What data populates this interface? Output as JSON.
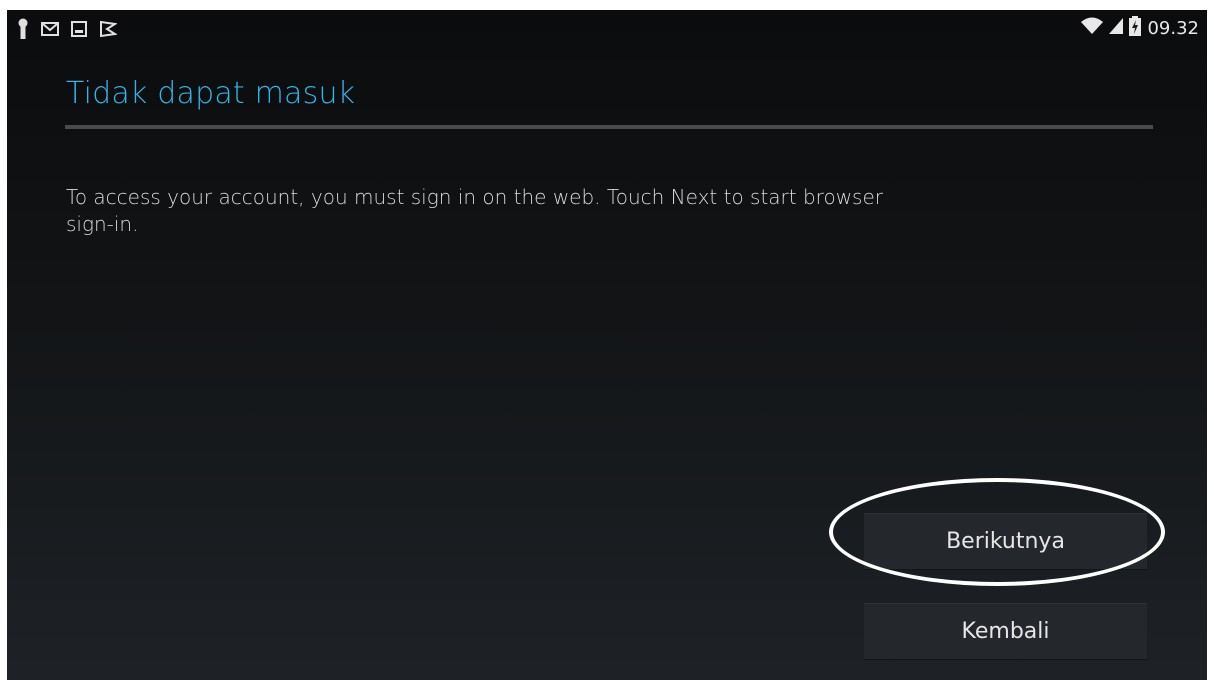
{
  "status_bar": {
    "left_icons": [
      "key-icon",
      "gmail-icon",
      "image-icon",
      "play-store-icon"
    ],
    "right_icons": [
      "wifi-icon",
      "signal-icon",
      "battery-charging-icon"
    ],
    "time": "09.32"
  },
  "dialog": {
    "title": "Tidak dapat masuk",
    "message": "To access your account, you must sign in on the web. Touch Next to start browser sign-in.",
    "next_button": "Berikutnya",
    "back_button": "Kembali"
  },
  "colors": {
    "title_accent": "#33b5e5",
    "background": "#121416",
    "button_bg": "#24282c",
    "annotation": "#ffffff"
  }
}
